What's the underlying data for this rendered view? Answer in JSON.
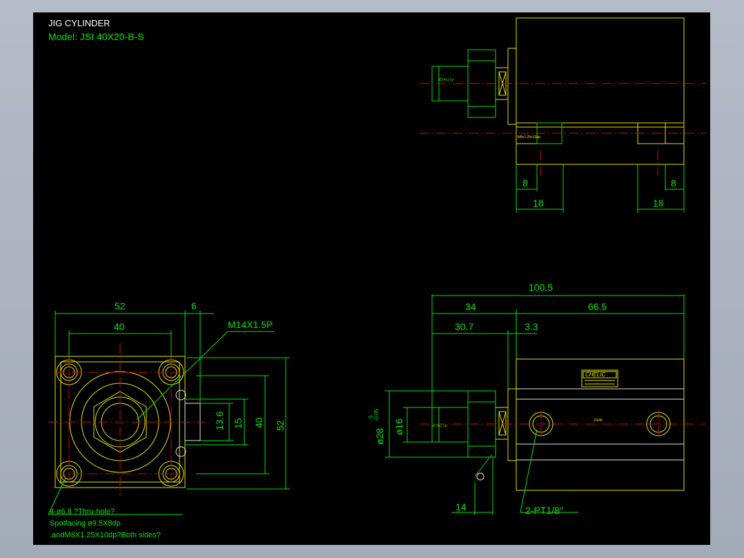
{
  "title": "JIG CYLINDER",
  "model": "Model: JSI 40X20-B-S",
  "top_view": {
    "rod_thread": "Ø14x1.5p",
    "side_thread": "M8x1.25x10dp",
    "dim_left_small": "8",
    "dim_right_small": "8",
    "dim_left": "18",
    "dim_right": "18"
  },
  "front_view": {
    "dim_width": "52",
    "dim_6": "6",
    "dim_40": "40",
    "thread_label": "M14X1.5P",
    "dim_13_6": "13.6",
    "dim_15": "15",
    "dim_40_v": "40",
    "dim_52_v": "52",
    "note_1": "4-ø6.8 ?Thru-hole?",
    "note_2": "Spotfacing ø9.5X8dp",
    "note_3": ".andM8X1.25X10dp?Both sides?"
  },
  "side_view": {
    "dim_total": "100.5",
    "dim_34": "34",
    "dim_66_5": "66.5",
    "dim_30_7": "30.7",
    "dim_3_3": "3.3",
    "dim_dia28": "ø28",
    "tol_upper": "0",
    "tol_lower": "-0.05",
    "dim_dia16": "ø16",
    "dim_14": "14",
    "port_label": "2-PT1/8\"",
    "brand": "CHELIC",
    "rod_thread": "M14x1.5p",
    "body_label": "JSI40"
  }
}
